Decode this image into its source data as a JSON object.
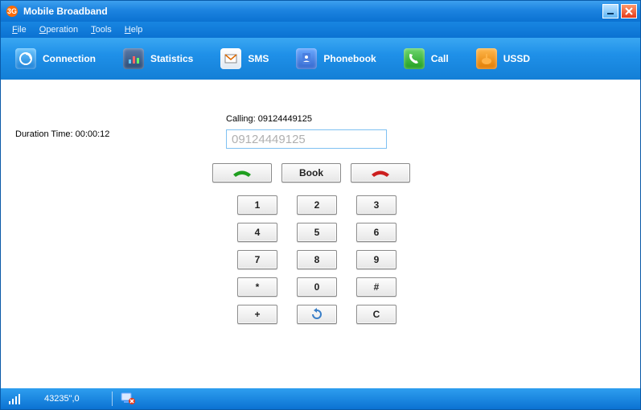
{
  "window": {
    "title": "Mobile Broadband"
  },
  "menus": {
    "file": "File",
    "operation": "Operation",
    "tools": "Tools",
    "help": "Help"
  },
  "toolbar": {
    "connection": "Connection",
    "statistics": "Statistics",
    "sms": "SMS",
    "phonebook": "Phonebook",
    "call": "Call",
    "ussd": "USSD"
  },
  "call": {
    "duration_label": "Duration Time: 00:00:12",
    "calling_label": "Calling: 09124449125",
    "number_value": "09124449125",
    "book_label": "Book"
  },
  "keypad": {
    "k1": "1",
    "k2": "2",
    "k3": "3",
    "k4": "4",
    "k5": "5",
    "k6": "6",
    "k7": "7",
    "k8": "8",
    "k9": "9",
    "kstar": "*",
    "k0": "0",
    "khash": "#",
    "kplus": "+",
    "kclear": "C"
  },
  "status": {
    "text": "43235\",0"
  }
}
